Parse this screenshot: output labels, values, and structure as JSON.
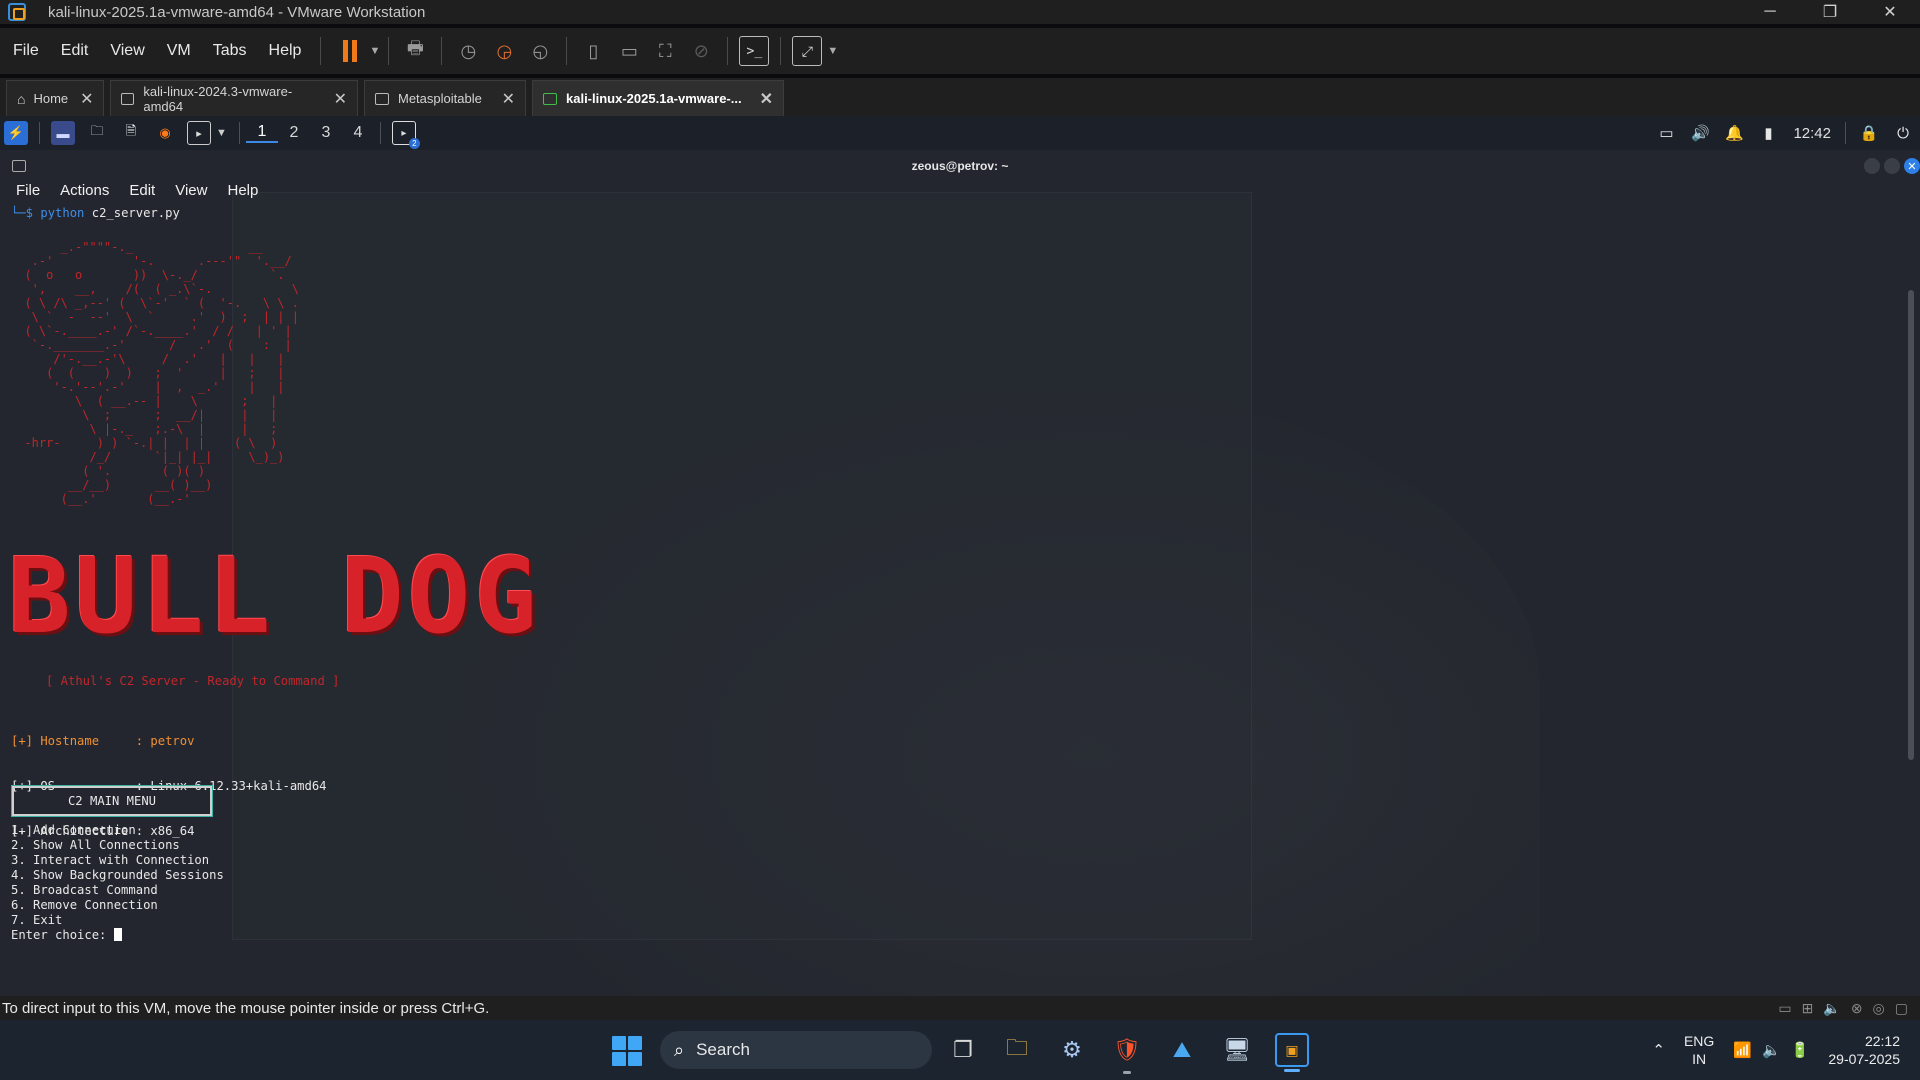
{
  "window": {
    "title": "kali-linux-2025.1a-vmware-amd64 - VMware Workstation",
    "controls": [
      "─",
      "❐",
      "✕"
    ]
  },
  "vmware_menu": [
    "File",
    "Edit",
    "View",
    "VM",
    "Tabs",
    "Help"
  ],
  "toolbar_icons": [
    "send-ctrl-alt-del-icon",
    "snapshot-icon",
    "revert-snapshot-icon",
    "snapshot-manager-icon",
    "library-icon",
    "thumbnail-bar-icon",
    "full-screen-icon",
    "unity-icon",
    "console-view-icon",
    "stretch-guest-icon"
  ],
  "tabs": [
    {
      "label": "Home",
      "icon": "home-icon"
    },
    {
      "label": "kali-linux-2024.3-vmware-amd64",
      "icon": "vm-icon"
    },
    {
      "label": "Metasploitable",
      "icon": "vm-icon"
    },
    {
      "label": "kali-linux-2025.1a-vmware-...",
      "icon": "vm-running-icon",
      "active": true
    }
  ],
  "kali_panel": {
    "workspaces": [
      "1",
      "2",
      "3",
      "4"
    ],
    "active_workspace": "1",
    "clock": "12:42",
    "term_badge": "2"
  },
  "terminal": {
    "title": "zeous@petrov: ~",
    "menu": [
      "File",
      "Actions",
      "Edit",
      "View",
      "Help"
    ],
    "prompt_symbol": "└─$",
    "command_prog": "python",
    "command_arg": "c2_server.py",
    "ascii_art": "       _.-\"\"\"\"-._                __\n   .-'           '-.      .---'\"  '.__/\n  (  o   o       ))  \\-._/          `.\n   ',    __,    /(  ( _.\\`-.           \\\n  ( \\ /\\ _,--' (  \\`-'  ` (  '-.   \\ \\ .\n   \\ `  -  --'  \\  `     .'  )  ;  | | |\n  ( \\`-.____.-' /`-.____.'  / /   | ' |\n   `-._______.-'      /   .'  (    :  |\n      /'-.__.-'\\     /  .'   |   |   |\n     (  (    )  )   ;  '     |   ;   |\n      '-.'--'.-'    |  ,  _.'    |   |\n         \\  ( __.-- |    \\      ;   |\n          \\  ;      ;  __/|     |   |\n           \\ |-._   ;.-\\  |     |   ;\n  -hrr-     ) ) `-.| |  | |    ( \\  )\n           /_/      `|_| |_|     \\_)_)\n          ( '.       ( )( )\n        __/__)      __( )__)\n       (__.'       (__.-'",
    "banner": "BULL DOG",
    "tagline": "[ Athul's C2 Server - Ready to Command ]",
    "info": [
      {
        "key": "[+] Hostname     : ",
        "value": "petrov"
      },
      {
        "key": "[+] OS           : ",
        "value": "Linux 6.12.33+kali-amd64"
      },
      {
        "key": "[+] Architecture : ",
        "value": "x86_64"
      }
    ],
    "menu_title": "C2 MAIN MENU",
    "options": [
      "1. Add Connection",
      "2. Show All Connections",
      "3. Interact with Connection",
      "4. Show Backgrounded Sessions",
      "5. Broadcast Command",
      "6. Remove Connection",
      "7. Exit"
    ],
    "input_prompt": "Enter choice: "
  },
  "status_bar": {
    "text": "To direct input to this VM, move the mouse pointer inside or press Ctrl+G."
  },
  "taskbar": {
    "search_placeholder": "Search",
    "apps": [
      "task-view-icon",
      "file-explorer-icon",
      "settings-icon",
      "brave-browser-icon",
      "photos-icon",
      "remote-desktop-icon",
      "vmware-icon"
    ],
    "lang_top": "ENG",
    "lang_bottom": "IN",
    "time": "22:12",
    "date": "29-07-2025"
  },
  "colors": {
    "accent_red": "#d8222a",
    "prompt_blue": "#3f8ee8",
    "info_orange": "#f09030",
    "vm_orange": "#f07a1a"
  }
}
